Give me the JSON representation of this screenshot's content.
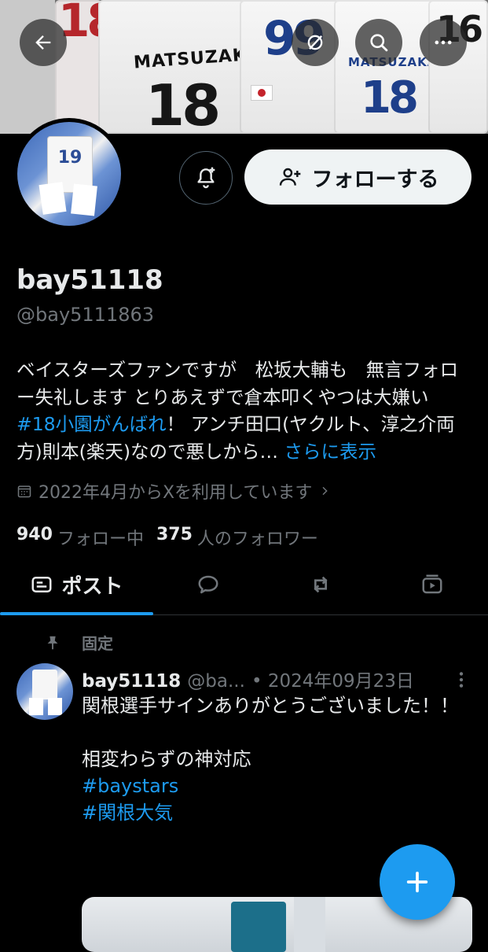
{
  "header": {
    "back_icon": "arrow-left-icon",
    "action_icons": [
      "grok-icon",
      "search-icon",
      "more-icon"
    ]
  },
  "profile": {
    "display_name": "bay51118",
    "handle": "@bay5111863",
    "follow_label": "フォローする",
    "bio": {
      "part1": "ベイスターズファンですが　松坂大輔も　無言フォロー失礼します とりあえずで倉本叩くやつは大嫌い ",
      "hashtag": "#18小園がんばれ",
      "part2": "！ アンチ田口(ヤクルト、淳之介両方)則本(楽天)なので悪しから… ",
      "more": "さらに表示"
    },
    "joined": "2022年4月からXを利用しています",
    "following_count": "940",
    "following_label": "フォロー中",
    "followers_count": "375",
    "followers_label": "人のフォロワー"
  },
  "tabs": [
    {
      "label": "ポスト",
      "icon": "posts-icon",
      "active": true
    },
    {
      "label": "",
      "icon": "replies-icon",
      "active": false
    },
    {
      "label": "",
      "icon": "repost-icon",
      "active": false
    },
    {
      "label": "",
      "icon": "media-icon",
      "active": false
    }
  ],
  "pinned_post": {
    "pinned_label": "固定",
    "author_name": "bay51118",
    "author_handle": "@ba...",
    "date": "• 2024年09月23日",
    "text": "関根選手サインありがとうございました！！\n\n相変わらずの神対応\n",
    "hashtag1": "#baystars",
    "hashtag2": "#関根大気"
  },
  "colors": {
    "accent": "#1d9bf0",
    "background": "#000000",
    "secondary_text": "#71767b"
  }
}
